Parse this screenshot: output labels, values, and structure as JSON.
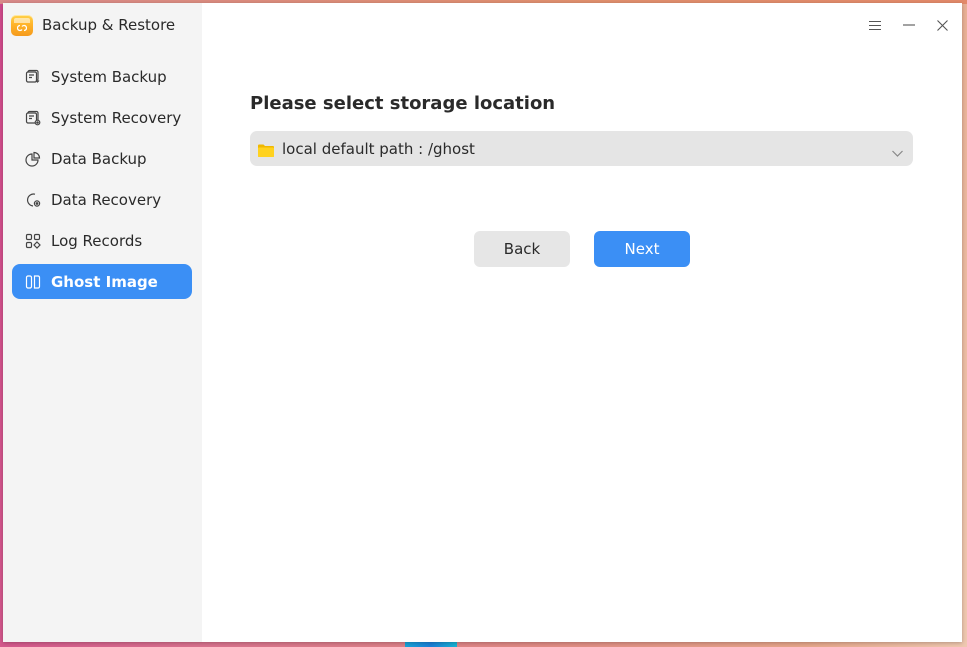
{
  "app": {
    "title": "Backup & Restore"
  },
  "window_controls": {
    "menu": "menu-icon",
    "minimize": "minimize-icon",
    "close": "close-icon"
  },
  "sidebar": {
    "items": [
      {
        "label": "System Backup",
        "icon": "system-backup-icon",
        "active": false
      },
      {
        "label": "System Recovery",
        "icon": "system-recovery-icon",
        "active": false
      },
      {
        "label": "Data Backup",
        "icon": "data-backup-icon",
        "active": false
      },
      {
        "label": "Data Recovery",
        "icon": "data-recovery-icon",
        "active": false
      },
      {
        "label": "Log Records",
        "icon": "log-records-icon",
        "active": false
      },
      {
        "label": "Ghost Image",
        "icon": "ghost-image-icon",
        "active": true
      }
    ]
  },
  "main": {
    "heading": "Please select storage location",
    "storage_select": {
      "value": "local default path : /ghost",
      "icon": "folder-icon"
    },
    "buttons": {
      "back": "Back",
      "next": "Next"
    }
  },
  "colors": {
    "accent": "#3b8ff5",
    "sidebar_bg": "#f4f4f4",
    "select_bg": "#e5e5e5",
    "folder": "#f5c518"
  }
}
